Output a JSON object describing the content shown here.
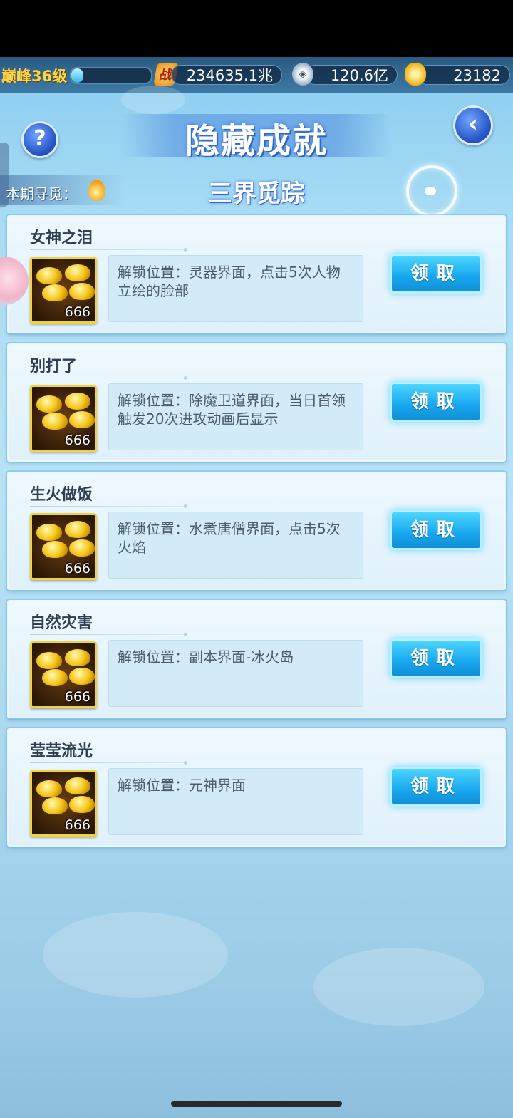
{
  "top_bar": {
    "level": "巅峰36级",
    "level_progress": 0.15,
    "power_icon": "战",
    "power": "234635.1兆",
    "silver": "120.6亿",
    "gold": "23182"
  },
  "header": {
    "title": "隐藏成就",
    "seek_label": "本期寻觅：",
    "subtitle": "三界觅踪"
  },
  "achievements": [
    {
      "title": "女神之泪",
      "reward_count": "666",
      "desc": "解锁位置：灵器界面，点击5次人物立绘的脸部",
      "button": "领取"
    },
    {
      "title": "别打了",
      "reward_count": "666",
      "desc": "解锁位置：除魔卫道界面，当日首领触发20次进攻动画后显示",
      "button": "领取"
    },
    {
      "title": "生火做饭",
      "reward_count": "666",
      "desc": "解锁位置：水煮唐僧界面，点击5次火焰",
      "button": "领取"
    },
    {
      "title": "自然灾害",
      "reward_count": "666",
      "desc": "解锁位置：副本界面-冰火岛",
      "button": "领取"
    },
    {
      "title": "莹莹流光",
      "reward_count": "666",
      "desc": "解锁位置：元神界面",
      "button": "领取"
    }
  ]
}
